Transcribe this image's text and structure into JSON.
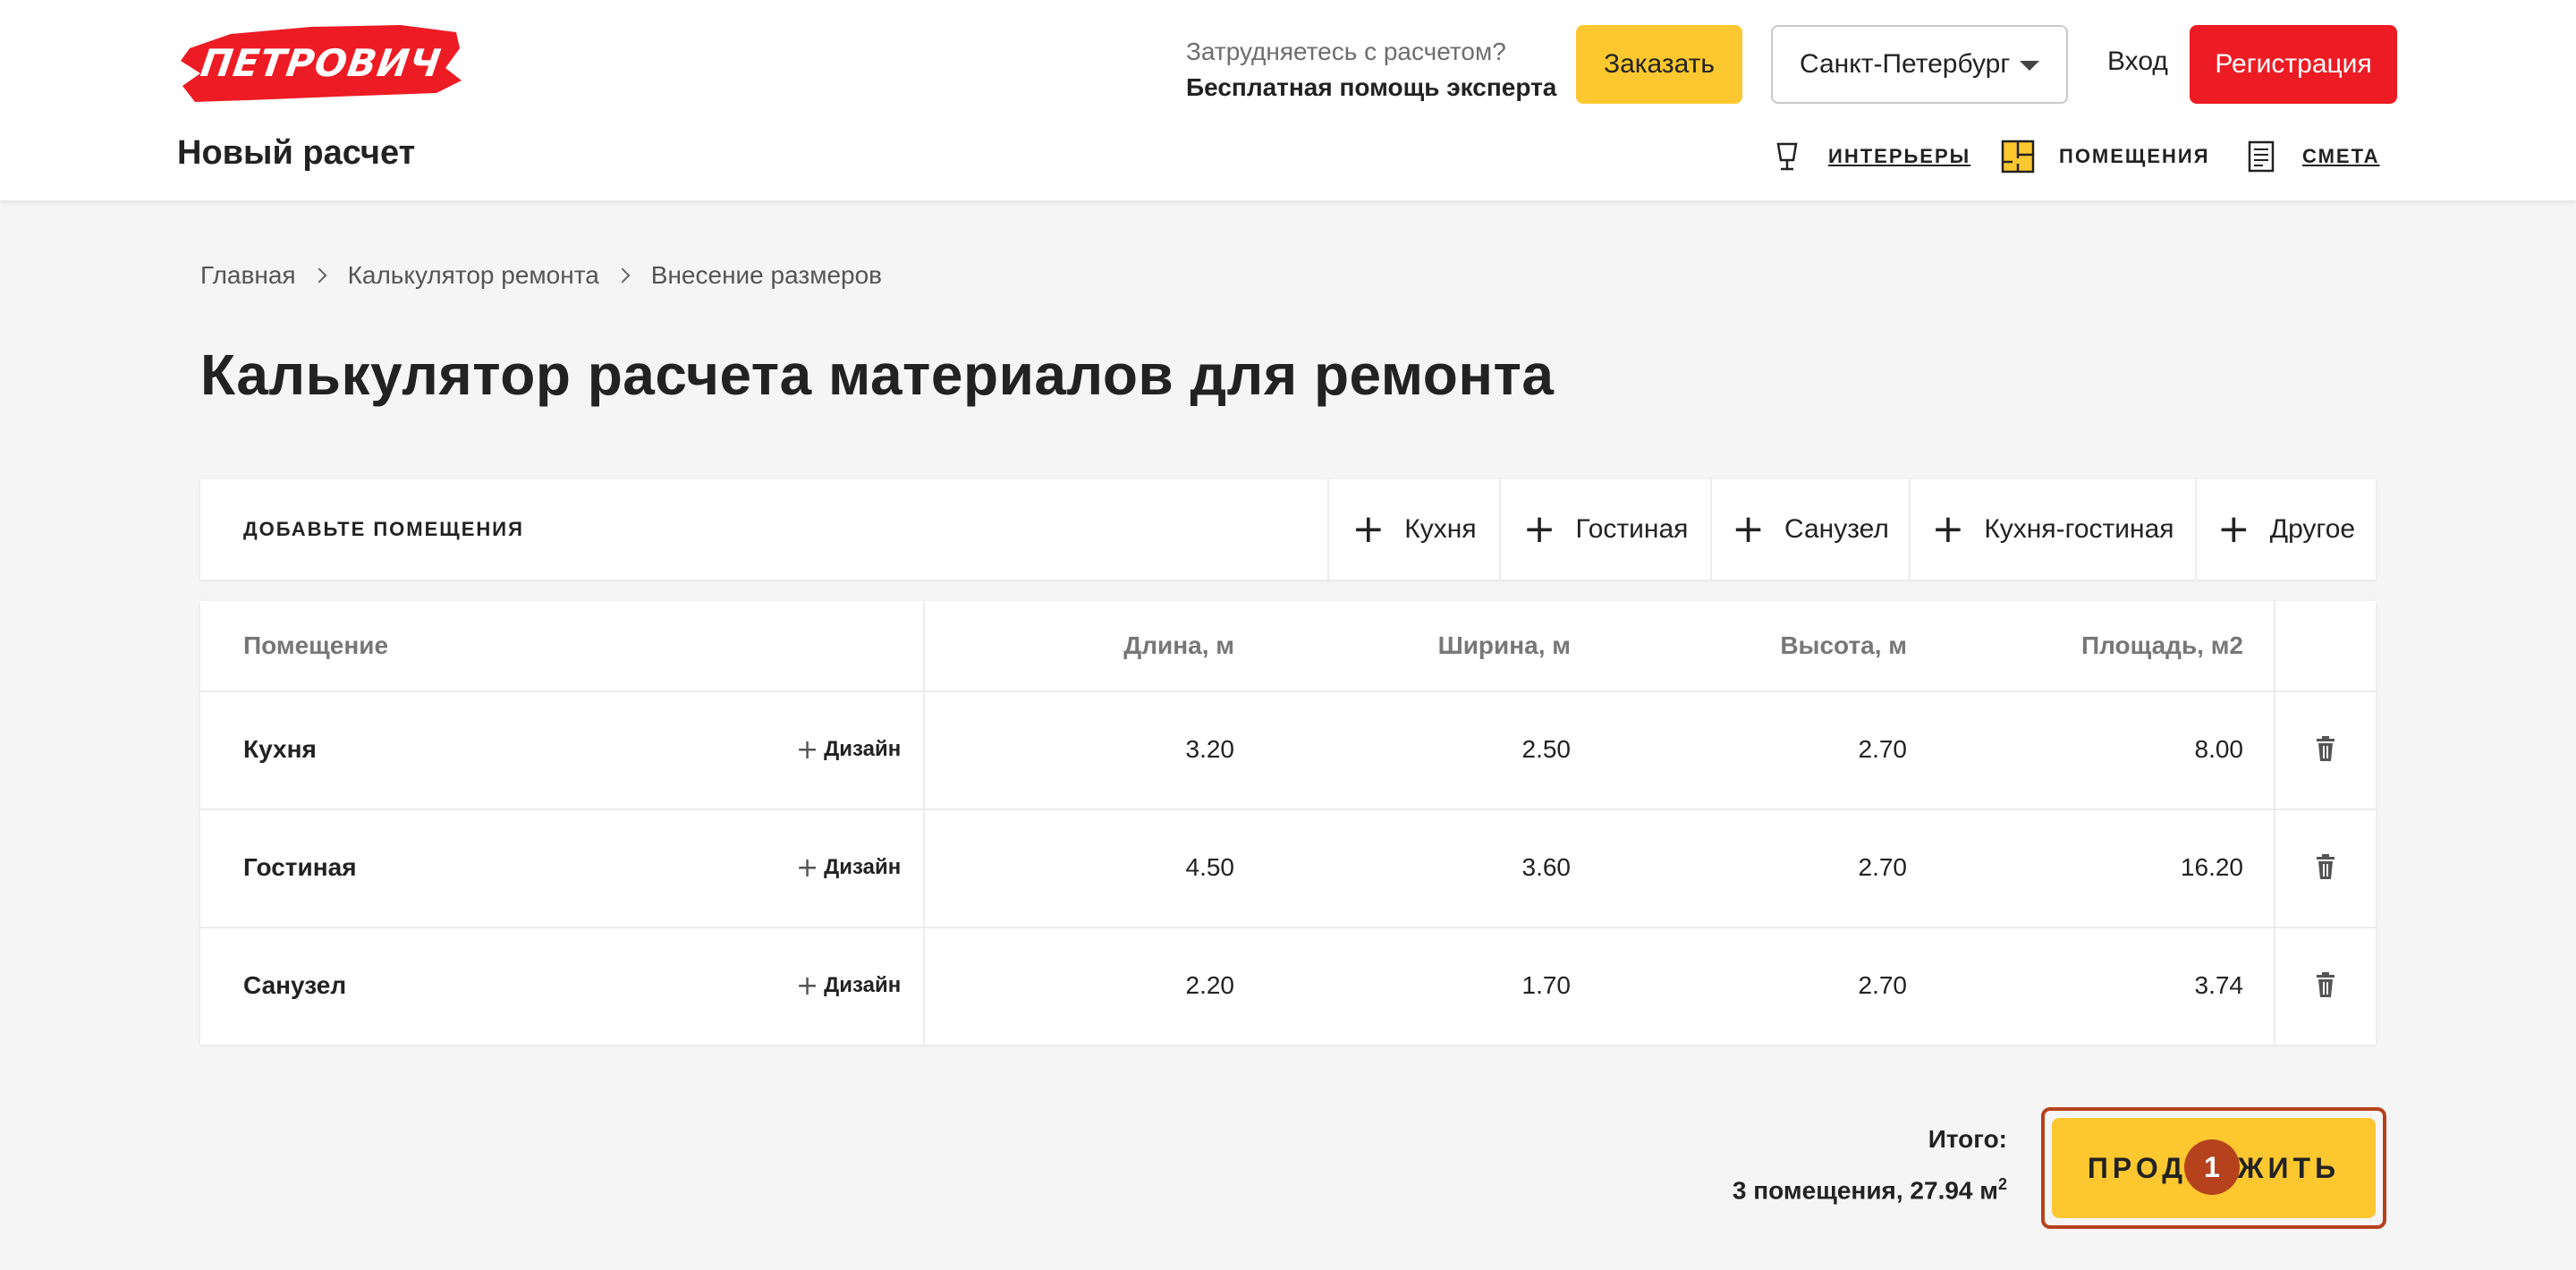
{
  "header": {
    "logo_text": "ПЕТРОВИЧ",
    "page_subtitle": "Новый расчет",
    "help_question": "Затрудняетесь с расчетом?",
    "help_answer": "Бесплатная помощь эксперта",
    "order_label": "Заказать",
    "city": "Санкт-Петербург",
    "login_label": "Вход",
    "register_label": "Регистрация",
    "nav": [
      {
        "label": "ИНТЕРЬЕРЫ",
        "icon": "lamp-icon"
      },
      {
        "label": "ПОМЕЩЕНИЯ",
        "icon": "floor-plan-icon"
      },
      {
        "label": "СМЕТА",
        "icon": "document-list-icon"
      }
    ]
  },
  "breadcrumb": [
    "Главная",
    "Калькулятор ремонта",
    "Внесение размеров"
  ],
  "title": "Калькулятор расчета материалов для ремонта",
  "add_rooms": {
    "label": "ДОБАВЬТЕ ПОМЕЩЕНИЯ",
    "buttons": [
      "Кухня",
      "Гостиная",
      "Санузел",
      "Кухня-гостиная",
      "Другое"
    ]
  },
  "table": {
    "headers": {
      "room": "Помещение",
      "length": "Длина, м",
      "width": "Ширина, м",
      "height": "Высота, м",
      "area": "Площадь, м2"
    },
    "design_label": "Дизайн",
    "rows": [
      {
        "room": "Кухня",
        "length": "3.20",
        "width": "2.50",
        "height": "2.70",
        "area": "8.00"
      },
      {
        "room": "Гостиная",
        "length": "4.50",
        "width": "3.60",
        "height": "2.70",
        "area": "16.20"
      },
      {
        "room": "Санузел",
        "length": "2.20",
        "width": "1.70",
        "height": "2.70",
        "area": "3.74"
      }
    ]
  },
  "total": {
    "label": "Итого:",
    "value": "3 помещения, 27.94 м",
    "unit_sup": "2"
  },
  "continue_label": "ПРОДОЛЖИТЬ",
  "marker_label": "1",
  "colors": {
    "brand_red": "#ed1c24",
    "accent_yellow": "#fdc82f",
    "highlight_border": "#b5421d"
  }
}
